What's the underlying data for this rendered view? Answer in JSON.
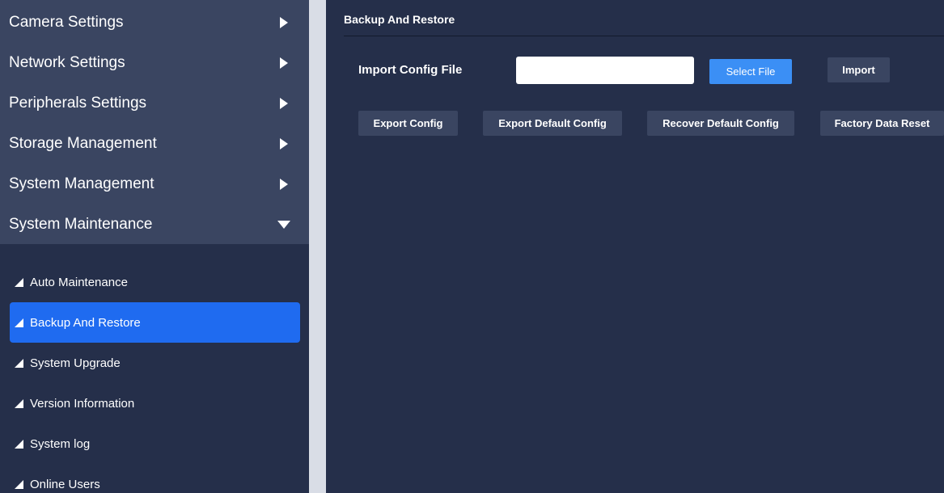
{
  "sidebar": {
    "main_items": [
      {
        "label": "Camera Settings"
      },
      {
        "label": "Network Settings"
      },
      {
        "label": "Peripherals Settings"
      },
      {
        "label": "Storage Management"
      },
      {
        "label": "System Management"
      },
      {
        "label": "System Maintenance"
      }
    ],
    "sub_items": [
      {
        "label": "Auto Maintenance"
      },
      {
        "label": "Backup And Restore"
      },
      {
        "label": "System Upgrade"
      },
      {
        "label": "Version Information"
      },
      {
        "label": "System log"
      },
      {
        "label": "Online Users"
      }
    ],
    "expanded_item": "System Maintenance",
    "active_sub_item": "Backup And Restore"
  },
  "content": {
    "title": "Backup And Restore",
    "import_label": "Import Config File",
    "file_input_value": "",
    "select_file_label": "Select File",
    "import_label_btn": "Import",
    "export_config_label": "Export Config",
    "export_default_label": "Export Default Config",
    "recover_default_label": "Recover Default Config",
    "factory_reset_label": "Factory Data Reset"
  },
  "colors": {
    "background": "#252f4a",
    "menu_background": "#3a4561",
    "active_blue": "#1f6bf0",
    "primary_button": "#3b8ff5"
  },
  "icons": {
    "collapsed": "chevron-right-icon",
    "expanded": "chevron-down-icon",
    "sub_item": "triangle-icon"
  }
}
